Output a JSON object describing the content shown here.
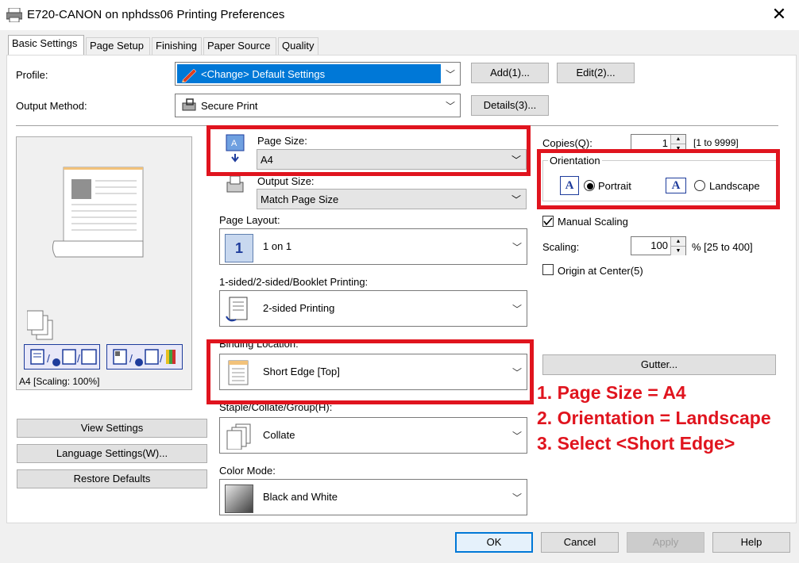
{
  "window": {
    "title": "E720-CANON on nphdss06 Printing Preferences",
    "close_icon": "close-icon"
  },
  "tabs": [
    "Basic Settings",
    "Page Setup",
    "Finishing",
    "Paper Source",
    "Quality"
  ],
  "profile": {
    "label": "Profile:",
    "value": "<Change> Default Settings",
    "add": "Add(1)...",
    "edit": "Edit(2)..."
  },
  "output_method": {
    "label": "Output Method:",
    "value": "Secure Print",
    "details": "Details(3)..."
  },
  "preview": {
    "status": "A4 [Scaling: 100%]"
  },
  "left_buttons": {
    "view": "View Settings",
    "language": "Language Settings(W)...",
    "restore": "Restore Defaults"
  },
  "page_size": {
    "label": "Page Size:",
    "value": "A4"
  },
  "output_size": {
    "label": "Output Size:",
    "value": "Match Page Size"
  },
  "page_layout": {
    "label": "Page Layout:",
    "value": "1 on 1",
    "icon_digit": "1"
  },
  "sided": {
    "label": "1-sided/2-sided/Booklet Printing:",
    "value": "2-sided Printing"
  },
  "binding": {
    "label": "Binding Location:",
    "value": "Short Edge [Top]"
  },
  "staple": {
    "label": "Staple/Collate/Group(H):",
    "value": "Collate"
  },
  "color_mode": {
    "label": "Color Mode:",
    "value": "Black and White"
  },
  "copies": {
    "label": "Copies(Q):",
    "value": "1",
    "range": "[1 to 9999]"
  },
  "orientation": {
    "label": "Orientation",
    "portrait": "Portrait",
    "landscape": "Landscape",
    "icon_letter": "A",
    "selected": "portrait"
  },
  "manual_scaling": {
    "label": "Manual Scaling",
    "checked": true
  },
  "scaling": {
    "label": "Scaling:",
    "value": "100",
    "range": "% [25 to 400]"
  },
  "origin": {
    "label": "Origin at Center(5)",
    "checked": false
  },
  "gutter": "Gutter...",
  "annotations": [
    "1. Page Size = A4",
    "2. Orientation = Landscape",
    "3. Select <Short Edge>"
  ],
  "footer": {
    "ok": "OK",
    "cancel": "Cancel",
    "apply": "Apply",
    "help": "Help"
  },
  "colors": {
    "annotation_red": "#e0141e",
    "selection_blue": "#0078d7",
    "accent_blue": "#1e3c9c"
  }
}
